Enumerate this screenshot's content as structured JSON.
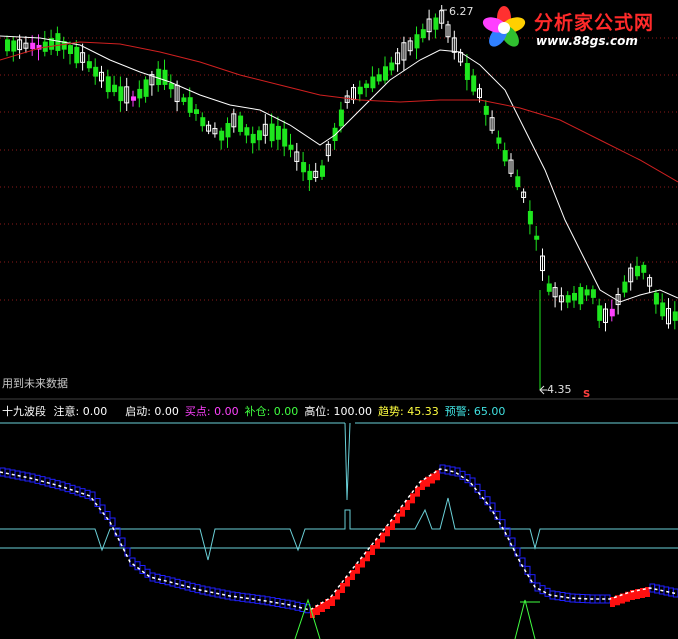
{
  "upper_note": "用到未来数据",
  "price_high_label": "6.27",
  "price_low_label": "4.35",
  "s_marker": "S",
  "logo": {
    "title": "分析家公式网",
    "url": "www.88gs.com"
  },
  "indicator": {
    "name": "十九波段",
    "fields": [
      {
        "label": "注意: ",
        "value": "0.00",
        "color": "#ffffff"
      },
      {
        "label": "启动: ",
        "value": "0.00",
        "color": "#ffffff"
      },
      {
        "label": "买点: ",
        "value": "0.00",
        "color": "#ff40ff"
      },
      {
        "label": "补仓: ",
        "value": "0.00",
        "color": "#40ff40"
      },
      {
        "label": "高位: ",
        "value": "100.00",
        "color": "#ffffff"
      },
      {
        "label": "趋势: ",
        "value": "45.33",
        "color": "#ffff40"
      },
      {
        "label": "预警: ",
        "value": "65.00",
        "color": "#40e0e0"
      }
    ]
  },
  "colors": {
    "up_candle": "#ffffff",
    "down_candle": "#1ee61e",
    "special_candle": "#ff40ff",
    "ma_short": "#ffffff",
    "ma_long": "#d02020",
    "grid": "#8b1a1a",
    "separator": "#8bd0e8",
    "trend_up": "#ff1010",
    "trend_down": "#2020ff",
    "warn_line": "#6ad0d8",
    "signal_line": "#40ff40"
  },
  "icons": {
    "logo": "pinwheel-logo-icon",
    "low_arrow": "arrow-left-icon"
  }
}
